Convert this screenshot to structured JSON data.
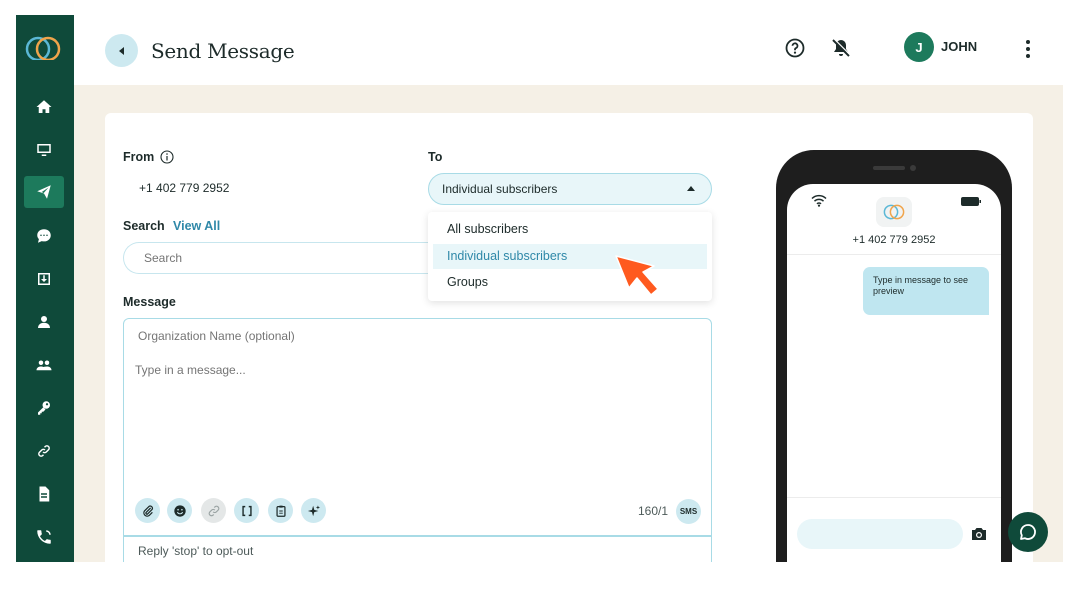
{
  "header": {
    "title": "Send Message",
    "user_initial": "J",
    "user_name": "JOHN"
  },
  "sidebar": {
    "items": [
      {
        "icon": "home-icon"
      },
      {
        "icon": "monitor-icon"
      },
      {
        "icon": "send-icon",
        "active": true
      },
      {
        "icon": "chat-bubble-icon"
      },
      {
        "icon": "inbox-download-icon"
      },
      {
        "icon": "person-icon"
      },
      {
        "icon": "people-icon"
      },
      {
        "icon": "key-icon"
      },
      {
        "icon": "link-icon"
      },
      {
        "icon": "document-icon"
      },
      {
        "icon": "phone-call-icon"
      }
    ]
  },
  "form": {
    "from_label": "From",
    "from_value": "+1 402 779 2952",
    "to_label": "To",
    "to_value": "Individual subscribers",
    "search_label": "Search",
    "view_all": "View All",
    "search_placeholder": "Search",
    "message_label": "Message",
    "org_placeholder": "Organization Name (optional)",
    "message_placeholder": "Type in a message...",
    "counter": "160/1",
    "sms_badge": "SMS",
    "optout": "Reply 'stop' to opt-out"
  },
  "dropdown": {
    "options": [
      "All subscribers",
      "Individual subscribers",
      "Groups"
    ],
    "selected": "Individual subscribers"
  },
  "toolbar": {
    "tools": [
      "paperclip-icon",
      "emoji-icon",
      "link-icon",
      "brackets-icon",
      "clipboard-icon",
      "sparkle-icon"
    ]
  },
  "preview": {
    "contact_number": "+1 402 779 2952",
    "bubble_text": "Type in message to see preview"
  },
  "colors": {
    "sidebar": "#0f4a3a",
    "accent": "#1d7a5c",
    "link": "#2f88a8",
    "light_blue": "#cde9f0",
    "content_bg": "#f5f0e6",
    "arrow": "#ff5a1f"
  }
}
